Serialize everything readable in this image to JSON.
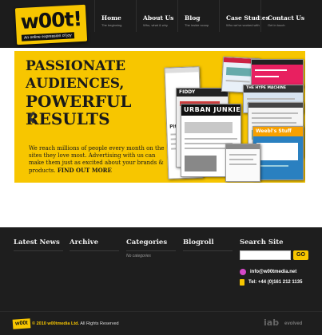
{
  "header": {
    "logo_text": "w00t!",
    "logo_tagline": "An online expression of joy",
    "nav": [
      {
        "title": "Home",
        "sub": "The beginning"
      },
      {
        "title": "About Us",
        "sub": "Who, what & why"
      },
      {
        "title": "Blog",
        "sub": "The inside scoop"
      },
      {
        "title": "Case Studies",
        "sub": "Who we've worked with"
      },
      {
        "title": "Contact Us",
        "sub": "Get in touch"
      }
    ]
  },
  "banner": {
    "headline": [
      "PASSIONATE",
      "AUDIENCES,",
      "POWERFUL",
      "RESULTS"
    ],
    "copy": "We reach millions of people every month on the sites they love most. Advertising with us can make them just as excited about your brands & products.",
    "cta": "FIND OUT MORE",
    "collage_labels": {
      "a": "Pitchfork",
      "b": "URBAN JUNKIE",
      "c": "Weebl's Stuff",
      "d": "THE HYPE MACHINE",
      "e": "FIDDY"
    },
    "colors": {
      "accent": "#f7c600",
      "background": "#1e1e1e"
    }
  },
  "footer": {
    "columns": {
      "news": "Latest News",
      "archive": "Archive",
      "categories": "Categories",
      "blogroll": "Blogroll",
      "search": "Search Site"
    },
    "no_categories": "No categories",
    "search_placeholder": "",
    "go_label": "GO",
    "email": "info@w00tmedia.net",
    "phone": "Tel: +44 (0)161 212 1135",
    "mini_logo": "w00t",
    "copyright_year": "© 2010 w00tmedia Ltd.",
    "copyright_rest": " All Rights Reserved",
    "iab": "iab",
    "evolved": "evolved"
  }
}
